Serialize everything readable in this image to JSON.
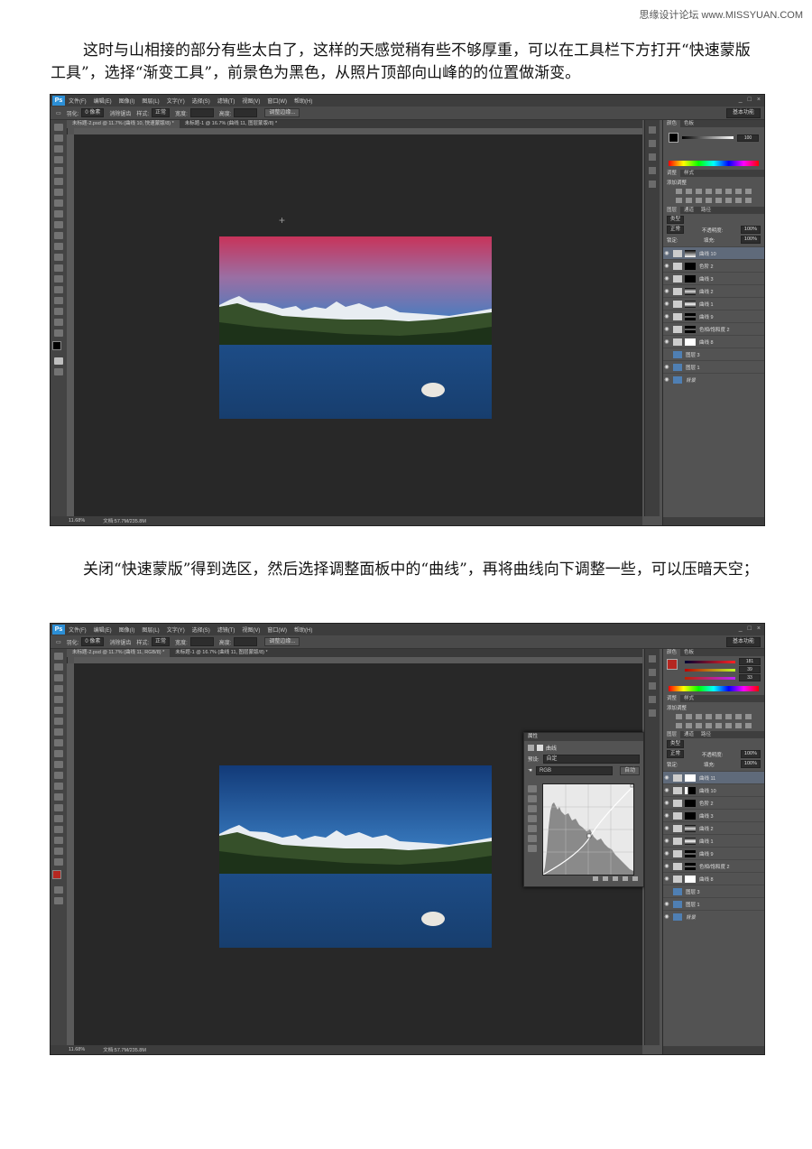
{
  "watermark": "思缘设计论坛 www.MISSYUAN.COM",
  "paragraphs": [
    "这时与山相接的部分有些太白了，这样的天感觉稍有些不够厚重，可以在工具栏下方打开“快速蒙版工具”，选择“渐变工具”，前景色为黑色，从照片顶部向山峰的的位置做渐变。",
    "关闭“快速蒙版”得到选区，然后选择调整面板中的“曲线”，再将曲线向下调整一些，可以压暗天空；"
  ],
  "app_logo": "Ps",
  "menu": [
    "文件(F)",
    "编辑(E)",
    "图像(I)",
    "图层(L)",
    "文字(Y)",
    "选择(S)",
    "滤镜(T)",
    "视图(V)",
    "窗口(W)",
    "帮助(H)"
  ],
  "window_controls": [
    "_",
    "□",
    "×"
  ],
  "options": {
    "feather_label": "羽化:",
    "feather_value": "0 像素",
    "antialias": "消除锯齿",
    "style_label": "样式:",
    "style_value": "正常",
    "width_label": "宽度:",
    "height_label": "高度:",
    "refine_button": "调整边缘...",
    "workspace": "基本功能"
  },
  "screens": [
    {
      "tabs": [
        "未标题-2.psd @ 11.7% (曲线 10, 快速蒙版/8) *",
        "未标题-1 @ 16.7% (曲线 11, 图层蒙版/8) *"
      ],
      "status_zoom": "11.68%",
      "status_doc": "文档:57.7M/235.8M",
      "color_tabs": [
        "颜色",
        "色板"
      ],
      "color_value": "100",
      "adjust_tabs": [
        "调整",
        "样式"
      ],
      "adjust_title": "添加调整",
      "layers_tabs": [
        "图层",
        "通道",
        "路径"
      ],
      "layer_kind": "类型",
      "blend_mode": "正常",
      "opacity_label": "不透明度:",
      "opacity_value": "100%",
      "lock_label": "锁定:",
      "fill_label": "填充:",
      "fill_value": "100%",
      "layers": [
        "曲线 10",
        "色阶 2",
        "曲线 3",
        "曲线 2",
        "曲线 1",
        "曲线 9",
        "色相/饱和度 2",
        "曲线 8",
        "图层 3",
        "图层 1",
        "背景"
      ]
    },
    {
      "tabs": [
        "未标题-2.psd @ 11.7% (曲线 11, RGB/8) *",
        "未标题-1 @ 16.7% (曲线 11, 图层蒙版/8) *"
      ],
      "status_zoom": "11.68%",
      "status_doc": "文档:57.7M/235.8M",
      "color_tabs": [
        "颜色",
        "色板"
      ],
      "rgb_values": [
        "181",
        "39",
        "33"
      ],
      "adjust_tabs": [
        "调整",
        "样式"
      ],
      "adjust_title": "添加调整",
      "layers_tabs": [
        "图层",
        "通道",
        "路径"
      ],
      "layer_kind": "类型",
      "blend_mode": "正常",
      "opacity_label": "不透明度:",
      "opacity_value": "100%",
      "lock_label": "锁定:",
      "fill_label": "填充:",
      "fill_value": "100%",
      "layers": [
        "曲线 11",
        "曲线 10",
        "色阶 2",
        "曲线 3",
        "曲线 2",
        "曲线 1",
        "曲线 9",
        "色相/饱和度 2",
        "曲线 8",
        "图层 3",
        "图层 1",
        "背景"
      ],
      "properties": {
        "title": "属性",
        "panel_name": "曲线",
        "preset_label": "预设:",
        "preset_value": "自定",
        "channel_value": "RGB",
        "auto_button": "自动"
      }
    }
  ],
  "colors": {
    "foreground_red": "#b52721",
    "sky_pink": "#c8335a",
    "sky_blue": "#2f64a8"
  }
}
